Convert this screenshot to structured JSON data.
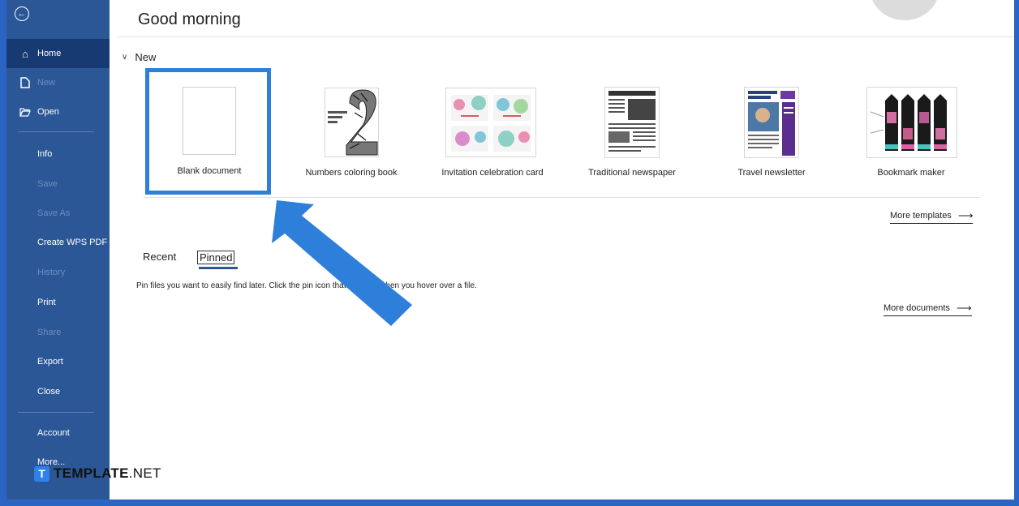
{
  "sidebar": {
    "items": [
      {
        "label": "Home"
      },
      {
        "label": "New"
      },
      {
        "label": "Open"
      },
      {
        "label": "Info"
      },
      {
        "label": "Save"
      },
      {
        "label": "Save As"
      },
      {
        "label": "Create WPS PDF"
      },
      {
        "label": "History"
      },
      {
        "label": "Print"
      },
      {
        "label": "Share"
      },
      {
        "label": "Export"
      },
      {
        "label": "Close"
      },
      {
        "label": "Account"
      },
      {
        "label": "More..."
      }
    ]
  },
  "header": {
    "greeting": "Good morning"
  },
  "new_section": {
    "title": "New",
    "templates": [
      {
        "label": "Blank document"
      },
      {
        "label": "Numbers coloring book"
      },
      {
        "label": "Invitation celebration card"
      },
      {
        "label": "Traditional newspaper"
      },
      {
        "label": "Travel newsletter"
      },
      {
        "label": "Bookmark maker"
      }
    ],
    "more_templates": "More templates"
  },
  "files": {
    "tabs": [
      {
        "label": "Recent"
      },
      {
        "label": "Pinned"
      }
    ],
    "pinned_message": "Pin files you want to easily find later. Click the pin icon that appears when you hover over a file.",
    "more_documents": "More documents"
  },
  "watermark": {
    "brand_bold": "TEMPLATE",
    "brand_rest": ".NET",
    "badge": "T"
  },
  "colors": {
    "sidebar": "#2b5797",
    "sidebar_active": "#173a72",
    "highlight": "#2d7fd9"
  }
}
